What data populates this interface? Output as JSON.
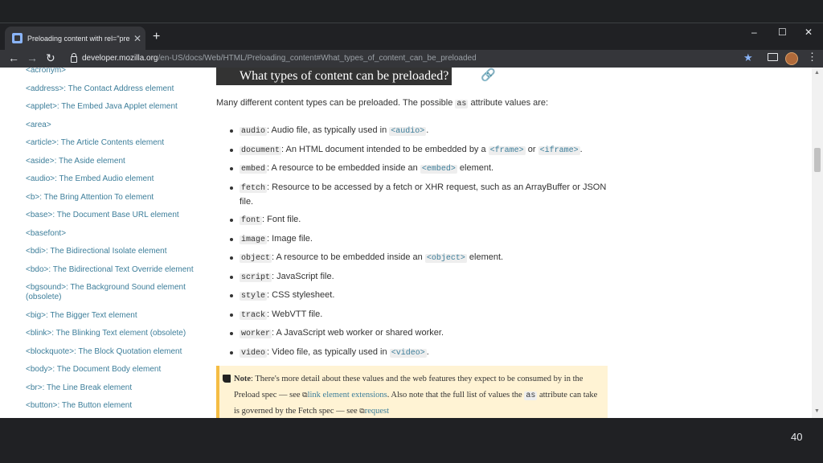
{
  "browser": {
    "tab_title": "Preloading content with rel=\"pre",
    "tab_close": "✕",
    "new_tab": "+",
    "url_host": "developer.mozilla.org",
    "url_path": "/en-US/docs/Web/HTML/Preloading_content#What_types_of_content_can_be_preloaded",
    "minimize": "–",
    "maximize": "☐",
    "close": "✕",
    "back": "←",
    "forward": "→",
    "reload": "↻",
    "star": "★",
    "menu": "⋮"
  },
  "sidebar": {
    "items": [
      "<acronym>",
      "<address>: The Contact Address element",
      "<applet>: The Embed Java Applet element",
      "<area>",
      "<article>: The Article Contents element",
      "<aside>: The Aside element",
      "<audio>: The Embed Audio element",
      "<b>: The Bring Attention To element",
      "<base>: The Document Base URL element",
      "<basefont>",
      "<bdi>: The Bidirectional Isolate element",
      "<bdo>: The Bidirectional Text Override element",
      "<bgsound>: The Background Sound element (obsolete)",
      "<big>: The Bigger Text element",
      "<blink>: The Blinking Text element (obsolete)",
      "<blockquote>: The Block Quotation element",
      "<body>: The Document Body element",
      "<br>: The Line Break element",
      "<button>: The Button element"
    ]
  },
  "main": {
    "heading": "What types of content can be preloaded?",
    "anchor_icon": "🔗",
    "intro_pre": "Many different content types can be preloaded. The possible ",
    "intro_code": "as",
    "intro_post": " attribute values are:",
    "items": [
      {
        "code": "audio",
        "pre": ": Audio file, as typically used in ",
        "link1": "<audio>",
        "mid": "",
        "link2": "",
        "post": "."
      },
      {
        "code": "document",
        "pre": ": An HTML document intended to be embedded by a ",
        "link1": "<frame>",
        "mid": " or ",
        "link2": "<iframe>",
        "post": "."
      },
      {
        "code": "embed",
        "pre": ": A resource to be embedded inside an ",
        "link1": "<embed>",
        "mid": "",
        "link2": "",
        "post": " element."
      },
      {
        "code": "fetch",
        "pre": ": Resource to be accessed by a fetch or XHR request, such as an ArrayBuffer or JSON file.",
        "link1": "",
        "mid": "",
        "link2": "",
        "post": ""
      },
      {
        "code": "font",
        "pre": ": Font file.",
        "link1": "",
        "mid": "",
        "link2": "",
        "post": ""
      },
      {
        "code": "image",
        "pre": ": Image file.",
        "link1": "",
        "mid": "",
        "link2": "",
        "post": ""
      },
      {
        "code": "object",
        "pre": ": A resource to be embedded inside an ",
        "link1": "<object>",
        "mid": "",
        "link2": "",
        "post": " element."
      },
      {
        "code": "script",
        "pre": ": JavaScript file.",
        "link1": "",
        "mid": "",
        "link2": "",
        "post": ""
      },
      {
        "code": "style",
        "pre": ": CSS stylesheet.",
        "link1": "",
        "mid": "",
        "link2": "",
        "post": ""
      },
      {
        "code": "track",
        "pre": ": WebVTT file.",
        "link1": "",
        "mid": "",
        "link2": "",
        "post": ""
      },
      {
        "code": "worker",
        "pre": ": A JavaScript web worker or shared worker.",
        "link1": "",
        "mid": "",
        "link2": "",
        "post": ""
      },
      {
        "code": "video",
        "pre": ": Video file, as typically used in ",
        "link1": "<video>",
        "mid": "",
        "link2": "",
        "post": "."
      }
    ]
  },
  "note": {
    "label": "Note",
    "text1": ": There's more detail about these values and the web features they expect to be consumed by in the Preload spec — see ",
    "link1": "link element extensions",
    "text2": ". Also note that the full list of values the ",
    "code": "as",
    "text3": " attribute can take is governed by the Fetch spec — see ",
    "link2": "request"
  },
  "slide": {
    "page_number": "40"
  },
  "colors": {
    "link": "#3d7e9a",
    "note_bg": "#fff3d4",
    "note_border": "#f5bd44",
    "heading_bg": "#333333"
  }
}
